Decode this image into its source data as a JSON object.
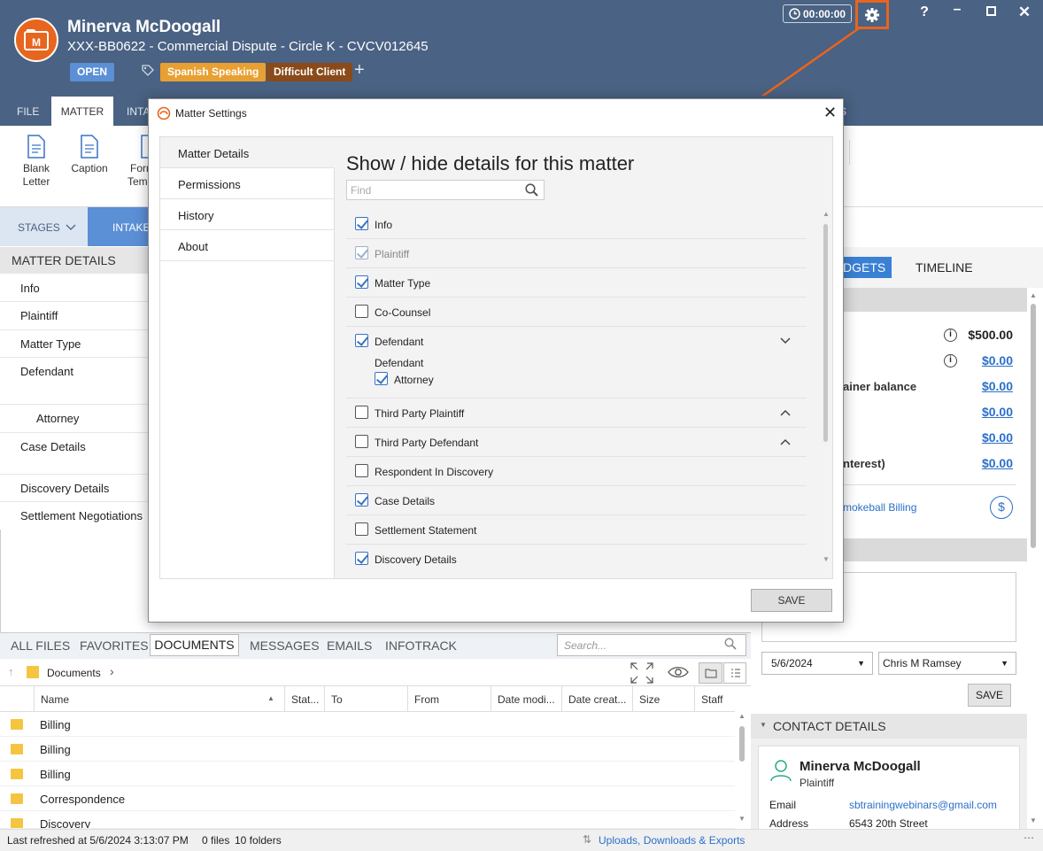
{
  "header": {
    "client_name": "Minerva McDoogall",
    "matter_title": "XXX-BB0622 - Commercial Dispute - Circle K - CVCV012645",
    "status_badge": "OPEN",
    "tags": [
      "Spanish Speaking",
      "Difficult Client"
    ],
    "timer": "00:00:00",
    "help": "?",
    "colors": {
      "header_bg": "#4a6283",
      "accent": "#e8651e",
      "open_badge": "#5b8fd6"
    }
  },
  "ribbon": {
    "tabs": [
      "FILE",
      "MATTER",
      "INTA"
    ],
    "tab_tail": "S",
    "buttons": [
      {
        "line1": "Blank",
        "line2": "Letter"
      },
      {
        "line1": "Caption",
        "line2": ""
      },
      {
        "line1": "Forr",
        "line2": "Temp"
      }
    ]
  },
  "stages": {
    "label": "STAGES",
    "intake": "INTAKE"
  },
  "matter_details": {
    "header": "MATTER DETAILS",
    "items": [
      "Info",
      "Plaintiff",
      "Matter Type",
      "Defendant",
      "Attorney",
      "Case Details",
      "Discovery Details",
      "Settlement Negotiations"
    ]
  },
  "right_panel": {
    "tab_budgets": "DGETS",
    "tab_timeline": "TIMELINE",
    "rows": [
      {
        "label": "",
        "value": "$500.00",
        "info": true
      },
      {
        "label": "",
        "value": "$0.00",
        "info": true
      },
      {
        "label": "ainer balance",
        "value": "$0.00",
        "info": false
      },
      {
        "label": "",
        "value": "$0.00",
        "info": false
      },
      {
        "label": "",
        "value": "$0.00",
        "info": false
      },
      {
        "label": "nterest)",
        "value": "$0.00",
        "info": false
      }
    ],
    "billing_link": "mokeball Billing",
    "note_date": "5/6/2024",
    "note_staff": "Chris M Ramsey",
    "note_save": "SAVE",
    "contact_header": "CONTACT DETAILS",
    "contact": {
      "name": "Minerva McDoogall",
      "role": "Plaintiff",
      "email_label": "Email",
      "email": "sbtrainingwebinars@gmail.com",
      "address_label": "Address",
      "address": "6543 20th Street"
    }
  },
  "documents": {
    "tabs": [
      "ALL FILES",
      "FAVORITES",
      "DOCUMENTS",
      "MESSAGES",
      "EMAILS",
      "INFOTRACK"
    ],
    "search_placeholder": "Search...",
    "path": "Documents",
    "columns": [
      "Name",
      "Stat...",
      "To",
      "From",
      "Date modi...",
      "Date creat...",
      "Size",
      "Staff"
    ],
    "rows": [
      "Billing",
      "Billing",
      "Billing",
      "Correspondence",
      "Discovery"
    ]
  },
  "status_bar": {
    "last_refreshed": "Last refreshed at 5/6/2024 3:13:07 PM",
    "files": "0 files",
    "folders": "10 folders",
    "uploads": "Uploads, Downloads & Exports"
  },
  "modal": {
    "title": "Matter Settings",
    "nav": [
      "Matter Details",
      "Permissions",
      "History",
      "About"
    ],
    "heading": "Show / hide details for this matter",
    "find_placeholder": "Find",
    "items": [
      {
        "label": "Info",
        "checked": true,
        "disabled": false,
        "chevron": ""
      },
      {
        "label": "Plaintiff",
        "checked": true,
        "disabled": true,
        "chevron": ""
      },
      {
        "label": "Matter Type",
        "checked": true,
        "disabled": false,
        "chevron": ""
      },
      {
        "label": "Co-Counsel",
        "checked": false,
        "disabled": false,
        "chevron": ""
      },
      {
        "label": "Defendant",
        "checked": true,
        "disabled": false,
        "chevron": "down"
      },
      {
        "label": "Third Party Plaintiff",
        "checked": false,
        "disabled": false,
        "chevron": "up"
      },
      {
        "label": "Third Party Defendant",
        "checked": false,
        "disabled": false,
        "chevron": "up"
      },
      {
        "label": "Respondent In Discovery",
        "checked": false,
        "disabled": false,
        "chevron": ""
      },
      {
        "label": "Case Details",
        "checked": true,
        "disabled": false,
        "chevron": ""
      },
      {
        "label": "Settlement Statement",
        "checked": false,
        "disabled": false,
        "chevron": ""
      },
      {
        "label": "Discovery Details",
        "checked": true,
        "disabled": false,
        "chevron": ""
      }
    ],
    "defendant_sub": {
      "heading": "Defendant",
      "item": "Attorney",
      "checked": true
    },
    "save": "SAVE"
  }
}
